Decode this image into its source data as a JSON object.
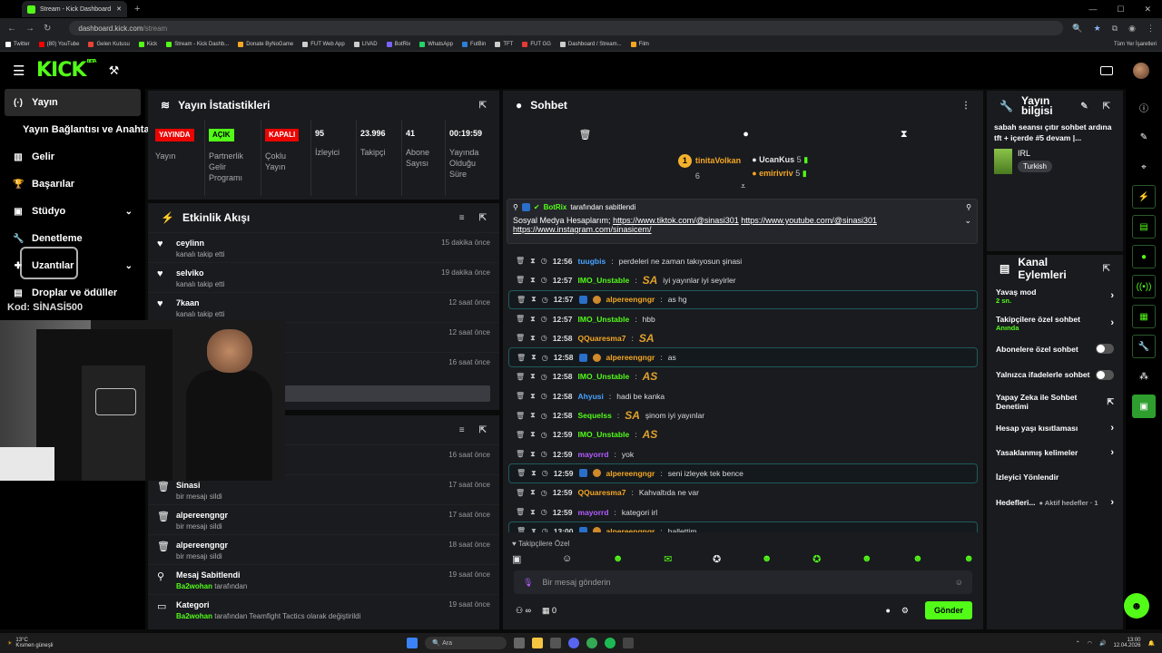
{
  "browser": {
    "tab_title": "Stream - Kick Dashboard",
    "url_host": "dashboard.kick.com",
    "url_path": "/stream",
    "bookmarks": [
      {
        "label": "Twitter",
        "color": "#ffffff"
      },
      {
        "label": "(80) YouTube",
        "color": "#ff0000"
      },
      {
        "label": "Gelen Kutusu",
        "color": "#ea4335"
      },
      {
        "label": "Kick",
        "color": "#53fc18"
      },
      {
        "label": "Stream - Kick Dashb...",
        "color": "#53fc18"
      },
      {
        "label": "Donate ByNoGame",
        "color": "#f5a623"
      },
      {
        "label": "FUT Web App",
        "color": "#cccccc"
      },
      {
        "label": "LIVAD",
        "color": "#cccccc"
      },
      {
        "label": "BotRix",
        "color": "#7b61ff"
      },
      {
        "label": "WhatsApp",
        "color": "#25d366"
      },
      {
        "label": "FutBin",
        "color": "#2e7dd7"
      },
      {
        "label": "TFT",
        "color": "#cccccc"
      },
      {
        "label": "FUT GG",
        "color": "#e53935"
      },
      {
        "label": "Dashboard / Stream...",
        "color": "#cccccc"
      },
      {
        "label": "Film",
        "color": "#f5a623"
      }
    ],
    "all_bookmarks": "Tüm Yer İşaretleri"
  },
  "header": {
    "logo": "KICK",
    "beta": "BETA"
  },
  "sidebar": {
    "items": [
      {
        "label": "Yayın",
        "icon": "broadcast-icon",
        "active": true
      },
      {
        "label": "Yayın Bağlantısı ve Anahtarı",
        "icon": "",
        "sub": true
      },
      {
        "label": "Gelir",
        "icon": "chart-icon"
      },
      {
        "label": "Başarılar",
        "icon": "trophy-icon"
      },
      {
        "label": "Stüdyo",
        "icon": "studio-icon",
        "chevron": true
      },
      {
        "label": "Denetleme",
        "icon": "wrench-icon"
      },
      {
        "label": "Uzantılar",
        "icon": "puzzle-icon",
        "chevron": true
      },
      {
        "label": "Droplar ve ödüller",
        "icon": "gift-icon"
      }
    ],
    "overlay_code": "Kod: SİNASİ500"
  },
  "stats": {
    "title": "Yayın İstatistikleri",
    "cols": [
      {
        "badge": "YAYINDA",
        "badge_color": "red",
        "label": "Yayın"
      },
      {
        "badge": "AÇIK",
        "badge_color": "green",
        "label": "Partnerlik Gelir Programı"
      },
      {
        "badge": "KAPALI",
        "badge_color": "red",
        "label": "Çoklu Yayın"
      },
      {
        "value": "95",
        "label": "İzleyici"
      },
      {
        "value": "23.996",
        "label": "Takipçi"
      },
      {
        "value": "41",
        "label": "Abone Sayısı"
      },
      {
        "value": "00:19:59",
        "label": "Yayında Olduğu Süre"
      }
    ]
  },
  "activity": {
    "title": "Etkinlik Akışı",
    "items": [
      {
        "name": "ceylinn",
        "sub": "kanalı takip etti",
        "time": "15 dakika önce",
        "icon": "heart-icon"
      },
      {
        "name": "selviko",
        "sub": "kanalı takip etti",
        "time": "19 dakika önce",
        "icon": "heart-icon"
      },
      {
        "name": "7kaan",
        "sub": "kanalı takip etti",
        "time": "12 saat önce",
        "icon": "heart-icon"
      },
      {
        "name": "",
        "sub": "",
        "time": "12 saat önce",
        "icon": "heart-icon"
      },
      {
        "name": "",
        "sub": "plam abonelik süresi - 2 ay!",
        "time": "16 saat önce",
        "icon": "star-icon"
      }
    ]
  },
  "audit": {
    "items": [
      {
        "name": "",
        "sub": "arak değiştirildi",
        "time": "16 saat önce",
        "icon": "pencil-icon"
      },
      {
        "name": "Sinasi",
        "sub": "bir mesajı sildi",
        "time": "17 saat önce",
        "icon": "trash-icon"
      },
      {
        "name": "alpereengngr",
        "sub": "bir mesajı sildi",
        "time": "17 saat önce",
        "icon": "trash-icon"
      },
      {
        "name": "alpereengngr",
        "sub": "bir mesajı sildi",
        "time": "18 saat önce",
        "icon": "trash-icon"
      },
      {
        "name": "Mesaj Sabitlendi",
        "sub_user": "Ba2wohan",
        "sub": "tarafından",
        "time": "19 saat önce",
        "icon": "pin-icon"
      },
      {
        "name": "Kategori",
        "sub_user": "Ba2wohan",
        "sub": "tarafından Teamfight Tactics olarak değiştirildi",
        "time": "19 saat önce",
        "icon": "category-icon"
      }
    ]
  },
  "chat": {
    "title": "Sohbet",
    "top_supporters": [
      {
        "name": "tinitaVolkan",
        "count": "6",
        "rank": "1"
      },
      {
        "name": "UcanKus",
        "count": "5"
      },
      {
        "name": "emirivriv",
        "count": "5"
      }
    ],
    "pinned": {
      "by": "BotRix",
      "by_suffix": "tarafından sabitlendi",
      "text": "Sosyal Medya Hesaplarım;",
      "link1": "https://www.tiktok.com/@sinasi301",
      "link2": "https://www.youtube.com/@sinasi301",
      "link3": "https://www.instagram.com/sinasicem/"
    },
    "messages": [
      {
        "time": "12:56",
        "user": "tuugbis",
        "color": "#4aa3ff",
        "text": "perdeleri ne zaman takıyosun şinasi"
      },
      {
        "time": "12:57",
        "user": "IMO_Unstable",
        "color": "#53fc18",
        "emote": "SA",
        "text": "iyi yayınlar iyi seyirler"
      },
      {
        "time": "12:57",
        "user": "alpereengngr",
        "color": "#f5a623",
        "text": "as hg",
        "hl": true
      },
      {
        "time": "12:57",
        "user": "IMO_Unstable",
        "color": "#53fc18",
        "text": "hbb"
      },
      {
        "time": "12:58",
        "user": "QQuaresma7",
        "color": "#f5a623",
        "emote": "SA",
        "text": ""
      },
      {
        "time": "12:58",
        "user": "alpereengngr",
        "color": "#f5a623",
        "text": "as",
        "hl": true
      },
      {
        "time": "12:58",
        "user": "IMO_Unstable",
        "color": "#53fc18",
        "emote": "AS",
        "text": ""
      },
      {
        "time": "12:58",
        "user": "Ahyusi",
        "color": "#4aa3ff",
        "text": "hadi be kanka"
      },
      {
        "time": "12:58",
        "user": "Sequelss",
        "color": "#53fc18",
        "emote": "SA",
        "text": "şinom iyi yayınlar"
      },
      {
        "time": "12:59",
        "user": "IMO_Unstable",
        "color": "#53fc18",
        "emote": "AS",
        "text": ""
      },
      {
        "time": "12:59",
        "user": "mayorrd",
        "color": "#b45cff",
        "text": "yok"
      },
      {
        "time": "12:59",
        "user": "alpereengngr",
        "color": "#f5a623",
        "text": "seni izleyek tek bence",
        "hl": true
      },
      {
        "time": "12:59",
        "user": "QQuaresma7",
        "color": "#f5a623",
        "text": "Kahvaltıda ne var"
      },
      {
        "time": "12:59",
        "user": "mayorrd",
        "color": "#b45cff",
        "text": "kategori irl"
      },
      {
        "time": "13:00",
        "user": "alpereengngr",
        "color": "#f5a623",
        "text": "hallettim",
        "hl": true
      }
    ],
    "followers_only": "Takipçilere Özel",
    "input_placeholder": "Bir mesaj gönderin",
    "infinity_label": "∞",
    "points": "0",
    "send": "Gönder"
  },
  "stream_info": {
    "title": "Yayın bilgisi",
    "text": "sabah seansı çıtır sohbet ardına tft + içerde #5 devam |...",
    "category": "IRL",
    "language": "Turkish"
  },
  "channel_actions": {
    "title": "Kanal Eylemleri",
    "rows": [
      {
        "label": "Yavaş mod",
        "sub": "2 sn.",
        "type": "chev"
      },
      {
        "label": "Takipçilere özel sohbet",
        "sub": "Anında",
        "type": "chev"
      },
      {
        "label": "Abonelere özel sohbet",
        "type": "toggle"
      },
      {
        "label": "Yalnızca ifadelerle sohbet",
        "type": "toggle"
      },
      {
        "label": "Yapay Zeka ile Sohbet Denetimi",
        "type": "ext"
      },
      {
        "label": "Hesap yaşı kısıtlaması",
        "type": "chev"
      },
      {
        "label": "Yasaklanmış kelimeler",
        "type": "chev"
      },
      {
        "label": "İzleyici Yönlendir",
        "type": "none"
      },
      {
        "label": "Hedefleri...",
        "sub": "● Aktif hedefler · 1",
        "type": "chev"
      }
    ]
  },
  "taskbar": {
    "weather_temp": "13°C",
    "weather_text": "Kısmen güneşli",
    "search": "Ara",
    "time": "13:00",
    "date": "12.04.2026"
  }
}
